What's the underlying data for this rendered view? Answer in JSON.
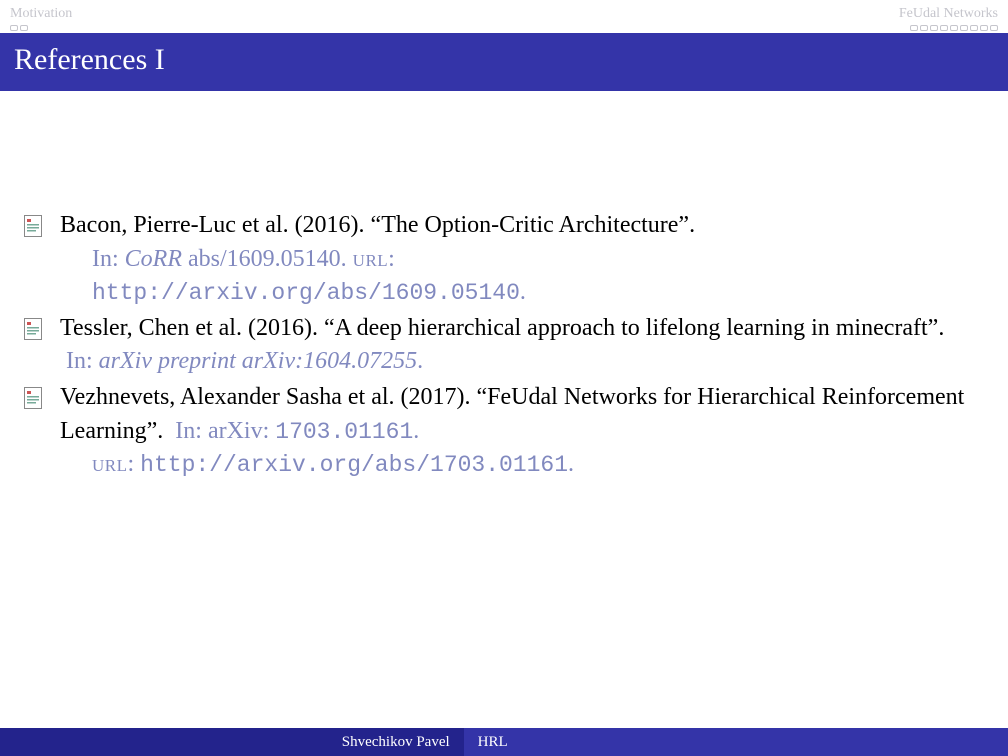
{
  "header": {
    "left_section": "Motivation",
    "right_section": "FeUdal Networks",
    "left_dots": 2,
    "right_dots": 9
  },
  "title": "References I",
  "references": [
    {
      "authors": "Bacon, Pierre-Luc et al. (2016).",
      "title": "“The Option-Critic Architecture”.",
      "in_label": "In:",
      "source": "CoRR",
      "source_extra": "abs/1609.05140.",
      "url_label": "url",
      "url": "http://arxiv.org/abs/1609.05140",
      "trailing": "."
    },
    {
      "authors": "Tessler, Chen et al. (2016).",
      "title": "“A deep hierarchical approach to lifelong learning in minecraft”.",
      "in_label": "In:",
      "source": "arXiv preprint arXiv:1604.07255",
      "trailing": "."
    },
    {
      "authors": "Vezhnevets, Alexander Sasha et al. (2017).",
      "title": "“FeUdal Networks for Hierarchical Reinforcement Learning”.",
      "in_label": "In:",
      "arxiv_label": "arXiv:",
      "arxiv_id": "1703.01161",
      "url_label": "url",
      "url": "http://arxiv.org/abs/1703.01161",
      "trailing": "."
    }
  ],
  "footer": {
    "author": "Shvechikov Pavel",
    "short_title": "HRL"
  }
}
